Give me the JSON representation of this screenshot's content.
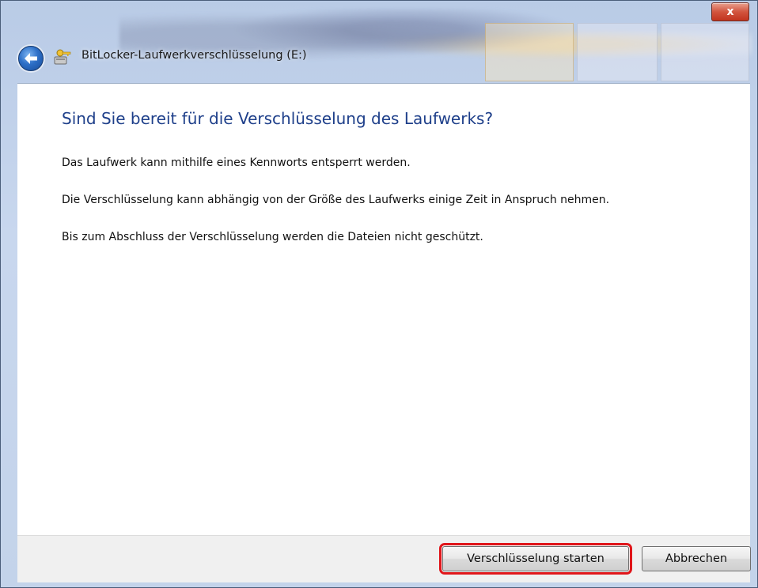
{
  "window": {
    "title": "BitLocker-Laufwerkverschlüsselung (E:)",
    "close_glyph": "x"
  },
  "content": {
    "heading": "Sind Sie bereit für die Verschlüsselung des Laufwerks?",
    "paragraphs": [
      "Das Laufwerk kann mithilfe eines Kennworts entsperrt werden.",
      "Die Verschlüsselung kann abhängig von der Größe des Laufwerks einige Zeit in Anspruch nehmen.",
      "Bis zum Abschluss der Verschlüsselung werden die Dateien nicht geschützt."
    ]
  },
  "footer": {
    "start_label": "Verschlüsselung starten",
    "cancel_label": "Abbrechen"
  },
  "colors": {
    "heading": "#1e3f8a",
    "highlight": "#e0161b"
  },
  "icons": [
    "back-arrow-icon",
    "bitlocker-key-icon",
    "close-icon"
  ]
}
